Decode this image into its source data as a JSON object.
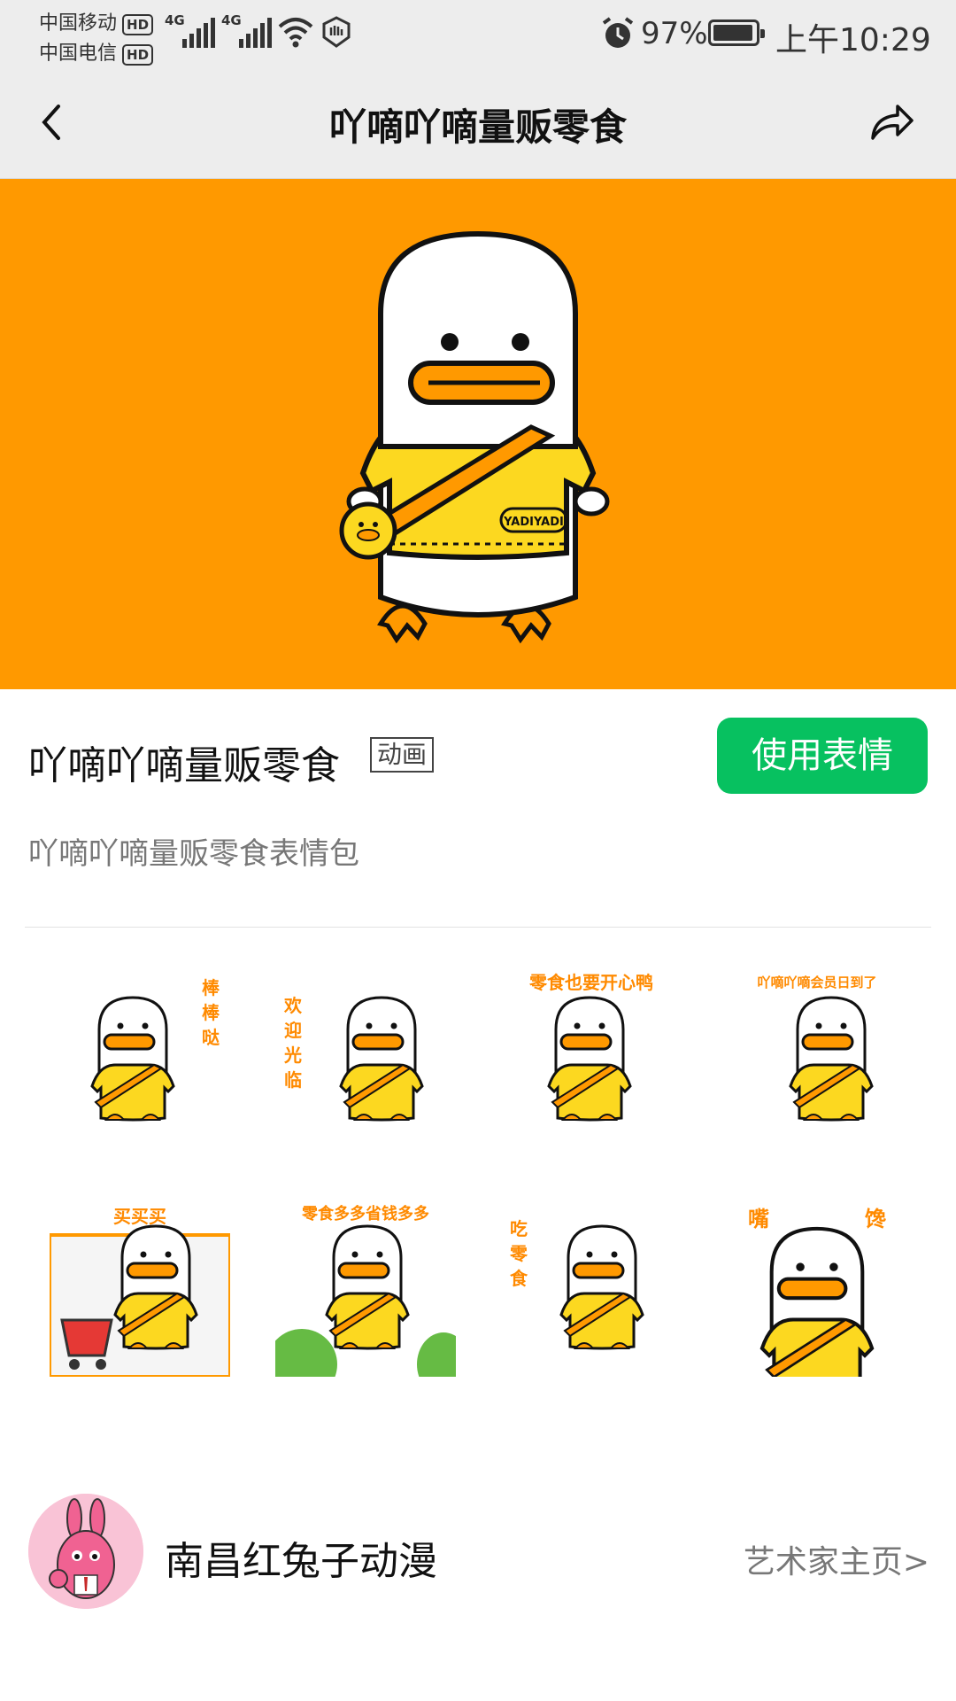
{
  "status_bar": {
    "carrier1": "中国移动",
    "carrier2": "中国电信",
    "hd": "HD",
    "net1": "4G",
    "net2": "4G",
    "battery_pct": "97%",
    "time": "上午10:29"
  },
  "nav": {
    "title": "吖嘀吖嘀量贩零食",
    "back_icon": "chevron-left-icon",
    "share_icon": "share-arrow-icon"
  },
  "banner": {
    "bg_color": "#ff9900",
    "bag_text": "YADIYADI"
  },
  "pack": {
    "title": "吖嘀吖嘀量贩零食",
    "badge": "动画",
    "use_button": "使用表情",
    "description": "吖嘀吖嘀量贩零食表情包"
  },
  "stickers": [
    {
      "caption": "棒棒哒"
    },
    {
      "caption": "欢迎光临"
    },
    {
      "caption": "零食也要开心鸭"
    },
    {
      "caption": "吖嘀吖嘀会员日到了"
    },
    {
      "caption": "买买买"
    },
    {
      "caption": "零食多多省钱多多"
    },
    {
      "caption": "吃零食"
    },
    {
      "caption": "嘴馋"
    }
  ],
  "artist": {
    "name": "南昌红兔子动漫",
    "link": "艺术家主页"
  },
  "colors": {
    "accent_green": "#07c160",
    "orange": "#ff9900",
    "yellow": "#fcd820"
  }
}
